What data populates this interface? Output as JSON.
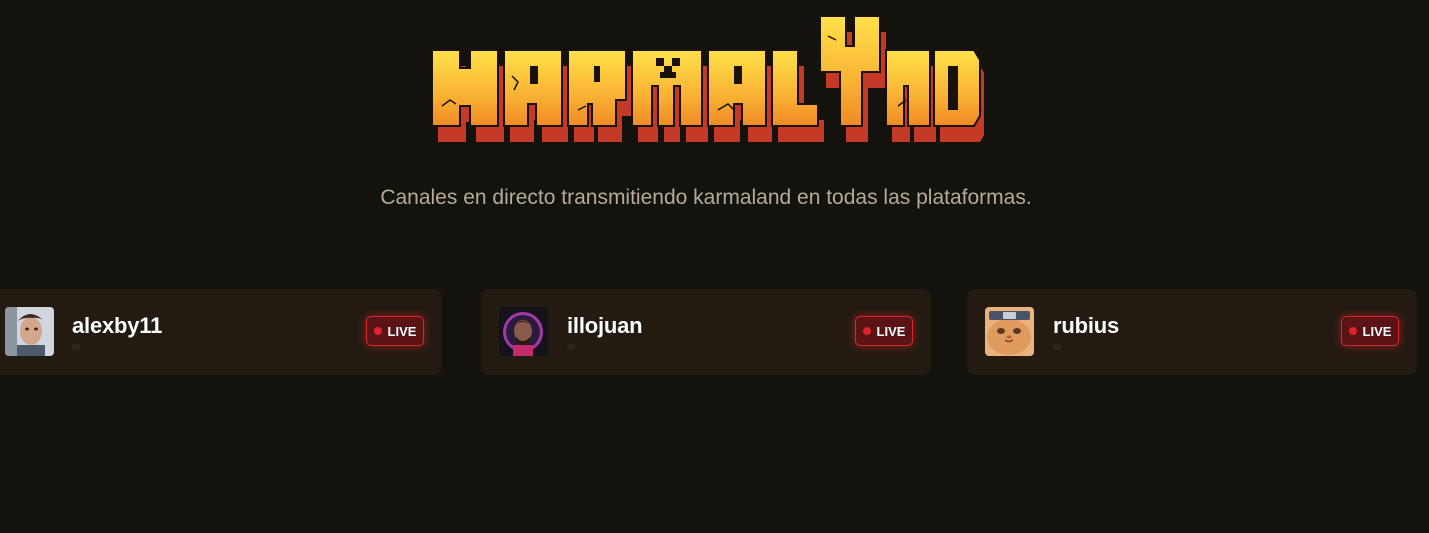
{
  "header": {
    "logo_text": "KARMALAND",
    "logo_colors": {
      "top": "#ffd540",
      "mid": "#f59a2a",
      "side": "#c8402a",
      "outline": "#1a1208"
    }
  },
  "subtitle": "Canales en directo transmitiendo karmaland en todas las plataformas.",
  "channels": [
    {
      "name": "alexby11",
      "status": "LIVE",
      "avatar_icon": "alexby11-avatar-photo"
    },
    {
      "name": "illojuan",
      "status": "LIVE",
      "avatar_icon": "illojuan-avatar-neon"
    },
    {
      "name": "rubius",
      "status": "LIVE",
      "avatar_icon": "rubius-avatar-cat"
    }
  ],
  "colors": {
    "background": "#13120d",
    "card": "#231b12",
    "live_border": "#d9262b",
    "live_dot": "#e0232a",
    "subtitle": "#b5ab99"
  }
}
